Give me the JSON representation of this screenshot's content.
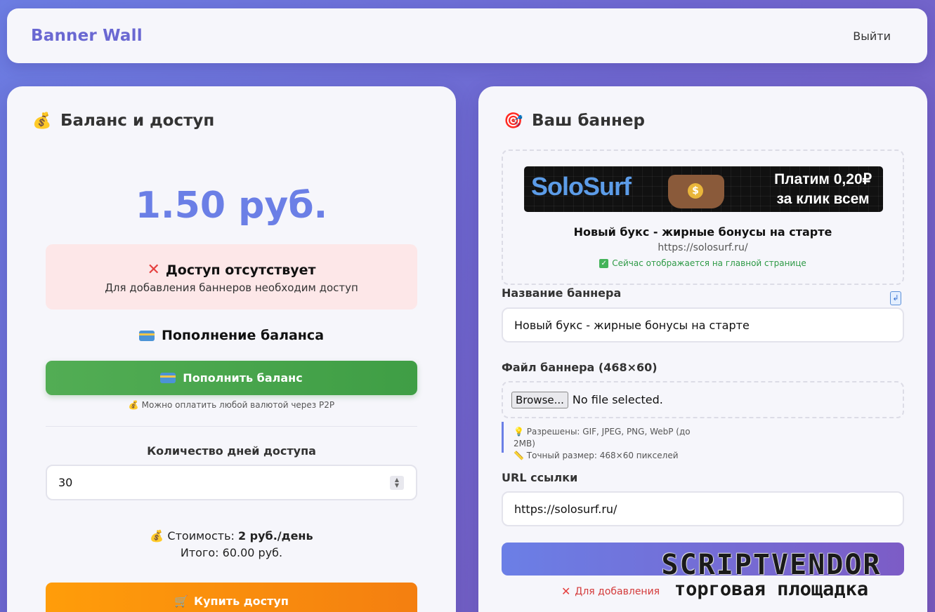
{
  "header": {
    "brand": "Banner Wall",
    "logout": "Выйти"
  },
  "left": {
    "title": "Баланс и доступ",
    "balance": "1.50 руб.",
    "access": {
      "title": "Доступ отсутствует",
      "subtitle": "Для добавления баннеров необходим доступ"
    },
    "topup_title": "Пополнение баланса",
    "topup_button": "Пополнить баланс",
    "p2p_note": "Можно оплатить любой валютой через P2P",
    "days_label": "Количество дней доступа",
    "days_value": "30",
    "cost_prefix": "Стоимость: ",
    "cost_value": "2 руб./день",
    "total": "Итого: 60.00 руб.",
    "buy_button": "Купить доступ"
  },
  "right": {
    "title": "Ваш баннер",
    "preview": {
      "banner_logo_a": "Solo",
      "banner_logo_b": "Surf",
      "banner_line1": "Платим 0,20₽",
      "banner_line2": "за клик всем",
      "title": "Новый букс - жирные бонусы на старте",
      "url": "https://solosurf.ru/",
      "status": "Сейчас отображается на главной странице"
    },
    "name_label": "Название баннера",
    "name_value": "Новый букс - жирные бонусы на старте",
    "file_label": "Файл баннера (468×60)",
    "browse_label": "Browse...",
    "file_status": "No file selected.",
    "hint_allowed": "Разрешены: GIF, JPEG, PNG, WebP (до 2MB)",
    "hint_size": "Точный размер: 468×60 пикселей",
    "url_label": "URL ссылки",
    "url_value": "https://solosurf.ru/",
    "no_access_note": "Для добавления"
  },
  "watermark": {
    "main": "SCRIPTVENDOR",
    "sub": "торговая площадка"
  }
}
